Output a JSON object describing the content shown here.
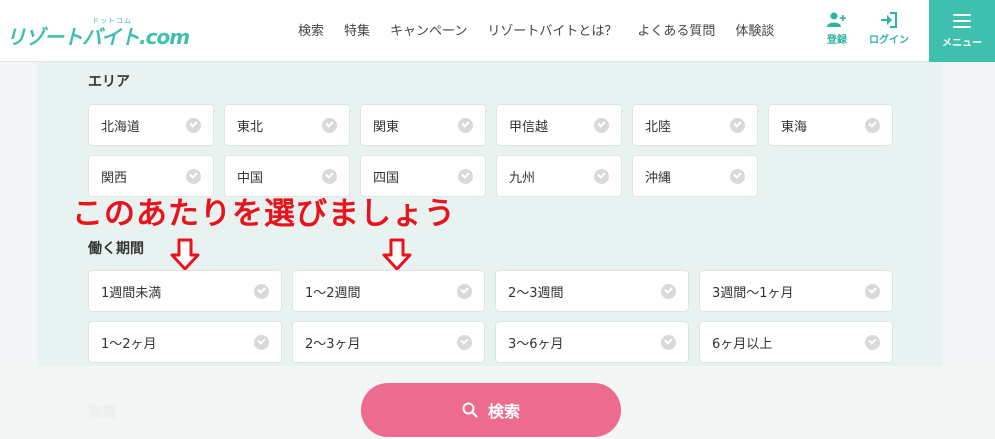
{
  "logo": {
    "main": "リゾートバイト.com",
    "sub": "ドットコム"
  },
  "nav": [
    "検索",
    "特集",
    "キャンペーン",
    "リゾートバイトとは？",
    "よくある質問",
    "体験談"
  ],
  "header_icons": {
    "register": "登録",
    "login": "ログイン",
    "menu": "メニュー"
  },
  "area": {
    "title": "エリア",
    "options": [
      "北海道",
      "東北",
      "関東",
      "甲信越",
      "北陸",
      "東海",
      "関西",
      "中国",
      "四国",
      "九州",
      "沖縄"
    ]
  },
  "annotation": "このあたりを選びましょう",
  "period": {
    "title": "働く期間",
    "options": [
      "1週間未満",
      "1～2週間",
      "2～3週間",
      "3週間～1ヶ月",
      "1～2ヶ月",
      "2～3ヶ月",
      "3～6ヶ月",
      "6ヶ月以上"
    ]
  },
  "next_section": {
    "title": "職種"
  },
  "search_button": {
    "label": "検索"
  },
  "colors": {
    "brand": "#3fbfad",
    "search": "#ec6b8f",
    "annotation": "#e8131c"
  }
}
